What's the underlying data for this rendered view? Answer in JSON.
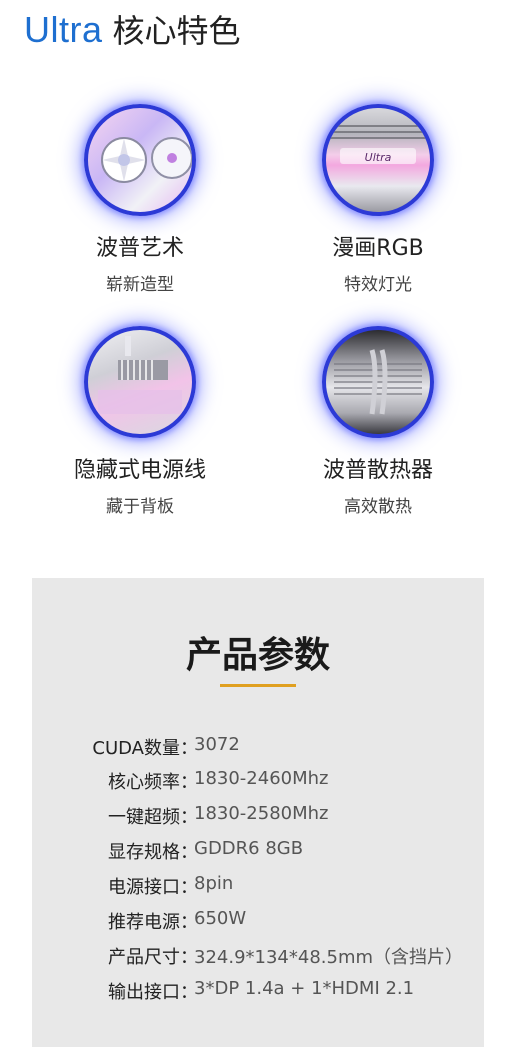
{
  "header": {
    "brand": "Ultra",
    "title": "核心特色"
  },
  "features": [
    {
      "name": "波普艺术",
      "desc": "崭新造型"
    },
    {
      "name": "漫画RGB",
      "desc": "特效灯光"
    },
    {
      "name": "隐藏式电源线",
      "desc": "藏于背板"
    },
    {
      "name": "波普散热器",
      "desc": "高效散热"
    }
  ],
  "specs": {
    "title": "产品参数",
    "rows": [
      {
        "key": "CUDA数量：",
        "value": "3072"
      },
      {
        "key": "核心频率：",
        "value": "1830-2460Mhz"
      },
      {
        "key": "一键超频：",
        "value": "1830-2580Mhz"
      },
      {
        "key": "显存规格：",
        "value": "GDDR6 8GB"
      },
      {
        "key": "电源接口：",
        "value": "8pin"
      },
      {
        "key": "推荐电源：",
        "value": "650W"
      },
      {
        "key": "产品尺寸：",
        "value": "324.9*134*48.5mm（含挡片）"
      },
      {
        "key": "输出接口：",
        "value": "3*DP 1.4a + 1*HDMI 2.1"
      }
    ]
  },
  "colors": {
    "brand_blue": "#1e6fd0",
    "accent_rule": "#e0a020",
    "ring": "#2c3ad6"
  }
}
